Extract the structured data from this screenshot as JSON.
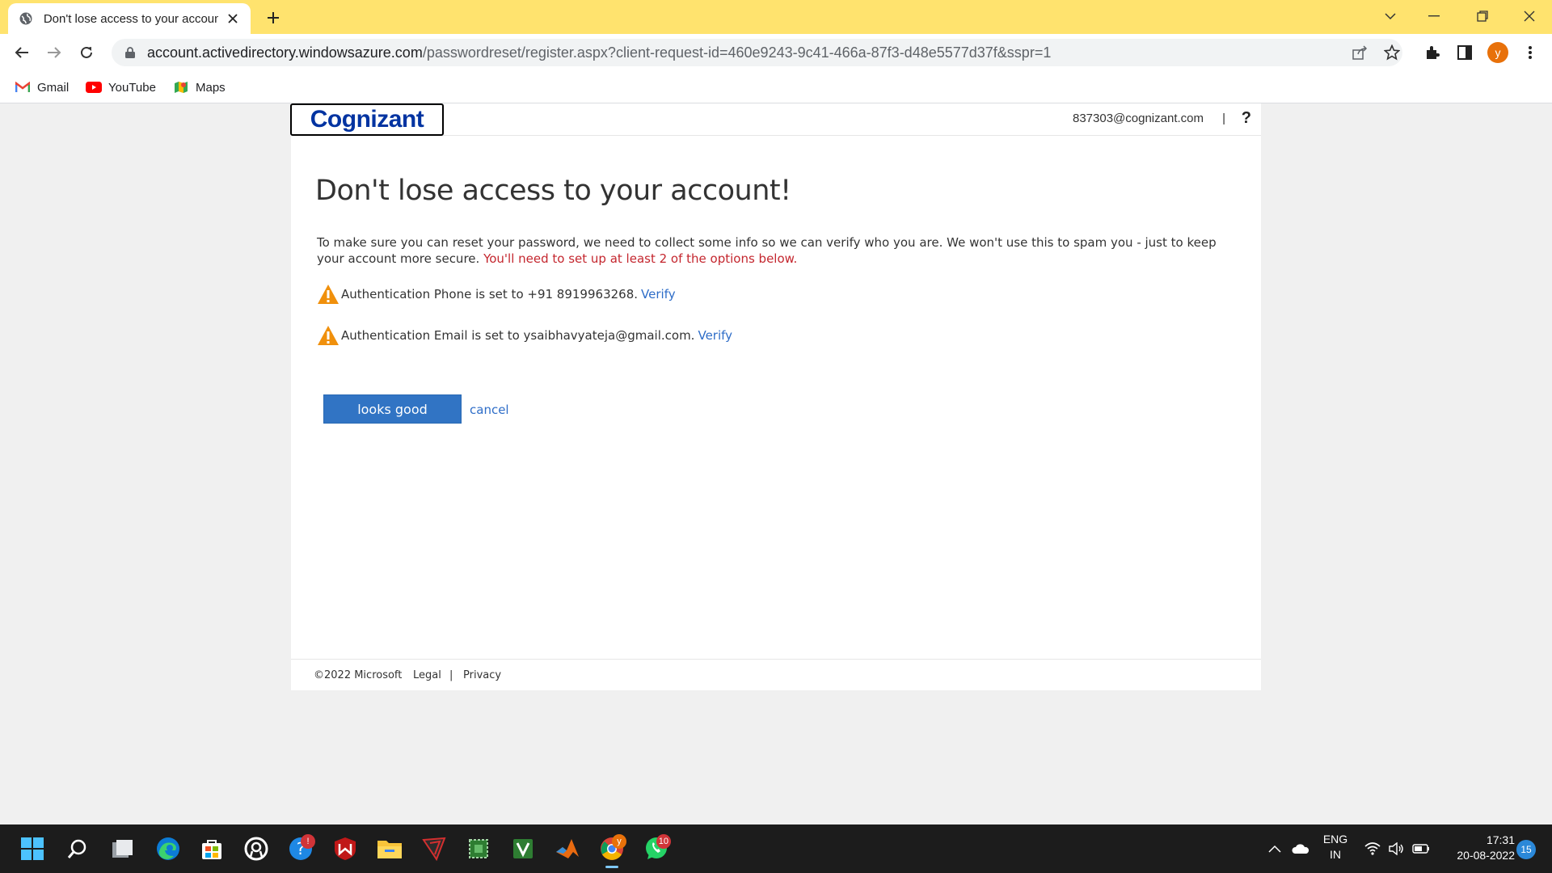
{
  "browser": {
    "tab": {
      "title": "Don't lose access to your account!"
    },
    "address": {
      "host": "account.activedirectory.windowsazure.com",
      "path": "/passwordreset/register.aspx?client-request-id=460e9243-9c41-466a-87f3-d48e5577d37f&sspr=1"
    },
    "profile_initial": "y",
    "bookmarks": [
      {
        "label": "Gmail",
        "icon": "gmail-icon"
      },
      {
        "label": "YouTube",
        "icon": "youtube-icon"
      },
      {
        "label": "Maps",
        "icon": "maps-icon"
      }
    ]
  },
  "page": {
    "logo_text": "Cognizant",
    "user_email": "837303@cognizant.com",
    "separator": "|",
    "help": "?",
    "heading": "Don't lose access to your account!",
    "intro_text": "To make sure you can reset your password, we need to collect some info so we can verify who you are. We won't use this to spam you - just to keep your account more secure.",
    "intro_warning": "You'll need to set up at least 2 of the options below.",
    "auth_phone": {
      "text": "Authentication Phone is set to +91 8919963268.",
      "link": "Verify"
    },
    "auth_email": {
      "text": "Authentication Email is set to ysaibhavyateja@gmail.com.",
      "link": "Verify"
    },
    "primary_button": "looks good",
    "cancel_link": "cancel",
    "footer": {
      "copyright": "©2022 Microsoft",
      "legal": "Legal",
      "separator": "|",
      "privacy": "Privacy"
    }
  },
  "taskbar": {
    "apps": [
      "start-icon",
      "search-icon",
      "task-view-icon",
      "edge-icon",
      "store-icon",
      "steam-icon",
      "helper-icon",
      "mcafee-icon",
      "file-explorer-icon",
      "app-icon",
      "greenshot-icon",
      "vs-icon",
      "matlab-icon",
      "chrome-icon",
      "whatsapp-icon"
    ],
    "helper_badge": "!",
    "whatsapp_badge": "10",
    "chrome_badge": "y",
    "language": "ENG",
    "region": "IN",
    "time": "17:31",
    "date": "20-08-2022",
    "notifications": "15"
  },
  "colors": {
    "titlebar": "#ffe36e",
    "brand": "#0033a1",
    "primary": "#3174c4",
    "link": "#2e6dc8",
    "warning": "#c4262e",
    "warn_icon": "#f0900c"
  }
}
